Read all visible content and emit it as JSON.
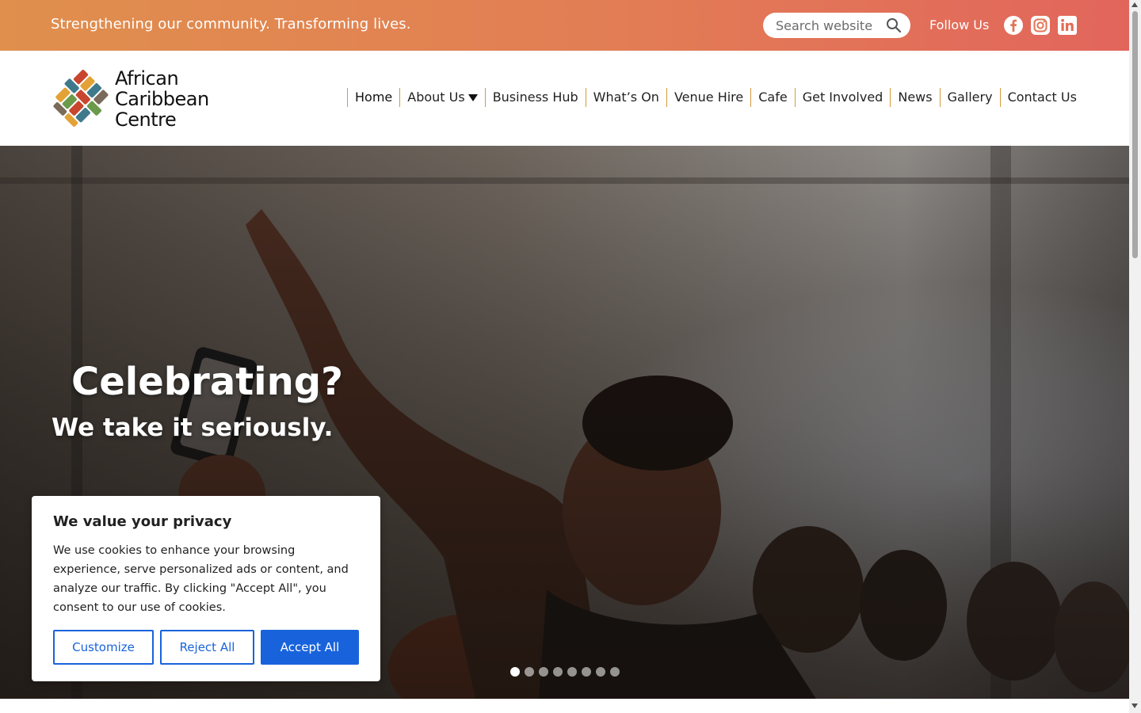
{
  "topbar": {
    "tagline": "Strengthening our community. Transforming lives.",
    "search_placeholder": "Search website",
    "follow_label": "Follow Us",
    "social": [
      "facebook-icon",
      "instagram-icon",
      "linkedin-icon"
    ]
  },
  "header": {
    "logo_lines": [
      "African",
      "Caribbean",
      "Centre"
    ],
    "nav": [
      {
        "label": "Home"
      },
      {
        "label": "About Us"
      },
      {
        "label": "Business Hub"
      },
      {
        "label": "What’s On"
      },
      {
        "label": "Venue Hire"
      },
      {
        "label": "Cafe"
      },
      {
        "label": "Get Involved"
      },
      {
        "label": "News"
      },
      {
        "label": "Gallery"
      },
      {
        "label": "Contact Us"
      }
    ]
  },
  "hero": {
    "title": "Celebrating?",
    "subtitle": "We take it seriously.",
    "slide_count": 8,
    "active_slide": 1
  },
  "cookie": {
    "title": "We value your privacy",
    "text": "We use cookies to enhance your browsing experience, serve personalized ads or content, and analyze our traffic. By clicking \"Accept All\", you consent to our use of cookies.",
    "customize": "Customize",
    "reject": "Reject All",
    "accept": "Accept All"
  },
  "colors": {
    "topbar_start": "#e08f4d",
    "topbar_end": "#e2655c",
    "nav_divider": "#d39a3a",
    "cookie_accent": "#1863dc"
  }
}
